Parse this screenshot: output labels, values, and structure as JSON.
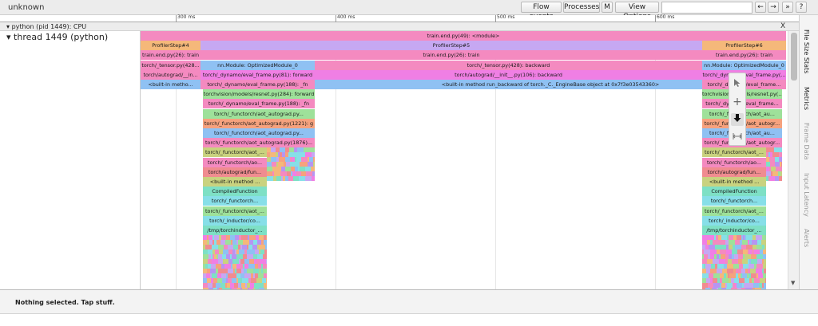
{
  "app": {
    "title": "unknown",
    "toolbar": {
      "flow_events": "Flow events",
      "processes": "Processes",
      "m": "M",
      "view_options": "View Options",
      "search_value": "",
      "prev": "←",
      "next": "→",
      "expand": "»",
      "help": "?"
    }
  },
  "ruler": {
    "ticks": [
      "300 ms",
      "400 ms",
      "500 ms",
      "600 ms"
    ]
  },
  "process": {
    "label": "python (pid 1449): CPU",
    "close": "X"
  },
  "thread": {
    "label": "thread 1449 (python)"
  },
  "sidebar": {
    "tabs": [
      "File Size Stats",
      "Metrics",
      "Frame Data",
      "Input Latency",
      "Alerts"
    ]
  },
  "palette": {
    "tools": [
      "select-tool",
      "pan-tool",
      "zoom-tool",
      "timing-tool"
    ]
  },
  "status": {
    "text": "Nothing selected. Tap stuff."
  },
  "flame_colors": {
    "pink": "#f48ac0",
    "blue": "#8fc1f3",
    "salmon": "#f6a27e",
    "orange": "#f5b87a",
    "lavender": "#c6a8f2",
    "purple": "#b695f2",
    "magenta": "#f07fe4",
    "green": "#9ee19a",
    "teal": "#7ee0c5",
    "olive": "#c9d27f",
    "cyan": "#87dfe8",
    "red": "#f08c90"
  },
  "flame": {
    "rows": [
      {
        "name": "row-0",
        "blocks": [
          {
            "text": "train.end.py(49): <module>",
            "color": "pink"
          }
        ]
      },
      {
        "name": "row-1",
        "blocks": [
          {
            "text": "ProfilerStep#4",
            "color": "orange"
          },
          {
            "text": "ProfilerStep#5",
            "color": "lavender"
          },
          {
            "text": "ProfilerStep#6",
            "color": "orange"
          }
        ]
      },
      {
        "name": "row-2",
        "blocks": [
          {
            "text": "train.end.py(26): train",
            "color": "pink"
          },
          {
            "text": "train.end.py(26): train",
            "color": "pink"
          },
          {
            "text": "train.end.py(26): train",
            "color": "pink"
          }
        ]
      },
      {
        "name": "row-3",
        "blocks": [
          {
            "text": "torch/_tensor.py(428...",
            "color": "pink"
          },
          {
            "text": "nn.Module: OptimizedModule_0",
            "color": "blue"
          },
          {
            "text": "torch/_tensor.py(428): backward",
            "color": "pink"
          },
          {
            "text": "nn.Module: OptimizedModule_0",
            "color": "blue"
          }
        ]
      },
      {
        "name": "row-4",
        "blocks": [
          {
            "text": "torch/autograd/__in...",
            "color": "pink"
          },
          {
            "text": "torch/_dynamo/eval_frame.py(81): forward",
            "color": "magenta"
          },
          {
            "text": "torch/autograd/__init__.py(106): backward",
            "color": "magenta"
          },
          {
            "text": "torch/_dynamo/eval_frame.py(...",
            "color": "magenta"
          }
        ]
      },
      {
        "name": "row-5",
        "blocks": [
          {
            "text": "<built-in metho...",
            "color": "blue"
          },
          {
            "text": "torch/_dynamo/eval_frame.py(188): _fn",
            "color": "pink"
          },
          {
            "text": "<built-in method run_backward of torch._C._EngineBase object at 0x7f3e03543360>",
            "color": "blue"
          },
          {
            "text": "torch/_dynamo/eval_frame...",
            "color": "pink"
          }
        ]
      },
      {
        "name": "row-6",
        "blocks": [
          {
            "text": "torchvision/models/resnet.py(284): forward",
            "color": "green"
          },
          {
            "text": "torchvision/models/resnet.py(...",
            "color": "green"
          }
        ]
      },
      {
        "name": "row-7",
        "blocks": [
          {
            "text": "torch/_dynamo/eval_frame.py(188): _fn",
            "color": "pink"
          },
          {
            "text": "torch/_dynamo/eval_frame...",
            "color": "pink"
          }
        ]
      },
      {
        "name": "row-8",
        "blocks": [
          {
            "text": "torch/_functorch/aot_autograd.py...",
            "color": "green"
          },
          {
            "text": "torch/_functorch/aot_au...",
            "color": "green"
          }
        ]
      },
      {
        "name": "row-9",
        "blocks": [
          {
            "text": "torch/_functorch/aot_autograd.py(1221): g",
            "color": "salmon"
          },
          {
            "text": "torch/_functorch/aot_autogr...",
            "color": "salmon"
          }
        ]
      },
      {
        "name": "row-10",
        "blocks": [
          {
            "text": "torch/_functorch/aot_autograd.py...",
            "color": "blue"
          },
          {
            "text": "torch/_functorch/aot_au...",
            "color": "blue"
          }
        ]
      },
      {
        "name": "row-11",
        "blocks": [
          {
            "text": "torch/_functorch/aot_autograd.py(1876)...",
            "color": "pink"
          },
          {
            "text": "torch/_functorch/aot_autogr...",
            "color": "pink"
          }
        ]
      },
      {
        "name": "row-12",
        "blocks": [
          {
            "text": "torch/_functorch/aot_...",
            "color": "olive"
          },
          {
            "text": "torch/_functorch/aot_...",
            "color": "olive"
          }
        ]
      },
      {
        "name": "row-13",
        "blocks": [
          {
            "text": "torch/_functorch/ao...",
            "color": "pink"
          },
          {
            "text": "torch/_functorch/ao...",
            "color": "pink"
          }
        ]
      },
      {
        "name": "row-14",
        "blocks": [
          {
            "text": "torch/autograd/fun...",
            "color": "red"
          },
          {
            "text": "torch/autograd/fun...",
            "color": "red"
          }
        ]
      },
      {
        "name": "row-15",
        "blocks": [
          {
            "text": "<built-in method ...",
            "color": "olive"
          },
          {
            "text": "<built-in method ...",
            "color": "olive"
          }
        ]
      },
      {
        "name": "row-16",
        "blocks": [
          {
            "text": "CompiledFunction",
            "color": "teal"
          },
          {
            "text": "CompiledFunction",
            "color": "teal"
          }
        ]
      },
      {
        "name": "row-17",
        "blocks": [
          {
            "text": "torch/_functorch...",
            "color": "cyan"
          },
          {
            "text": "torch/_functorch...",
            "color": "cyan"
          }
        ]
      },
      {
        "name": "row-18",
        "blocks": [
          {
            "text": "torch/_functorch/aot_...",
            "color": "green"
          },
          {
            "text": "torch/_functorch/aot_...",
            "color": "green"
          }
        ]
      },
      {
        "name": "row-19",
        "blocks": [
          {
            "text": "torch/_inductor/co...",
            "color": "cyan"
          },
          {
            "text": "torch/_inductor/co...",
            "color": "cyan"
          }
        ]
      },
      {
        "name": "row-20",
        "blocks": [
          {
            "text": "/tmp/torchinductor_...",
            "color": "teal"
          },
          {
            "text": "/tmp/torchinductor_...",
            "color": "teal"
          }
        ]
      }
    ]
  }
}
